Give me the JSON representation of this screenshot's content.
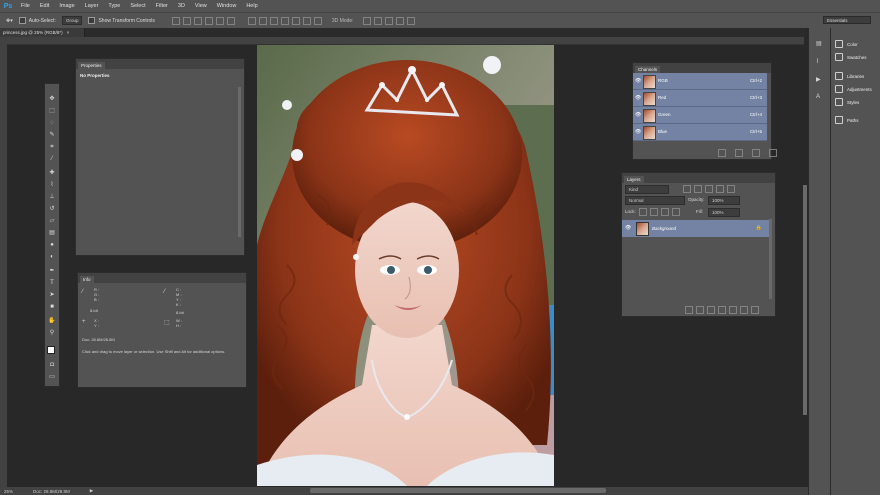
{
  "app": {
    "logo": "Ps"
  },
  "menu": [
    "File",
    "Edit",
    "Image",
    "Layer",
    "Type",
    "Select",
    "Filter",
    "3D",
    "View",
    "Window",
    "Help"
  ],
  "options": {
    "auto_select_label": "Auto-Select:",
    "auto_select_value": "Group",
    "transform_label": "Show Transform Controls",
    "mode_3d": "3D Mode:",
    "workspace": "Essentials"
  },
  "document": {
    "tab_title": "princess.jpg @ 25% (RGB/8*)",
    "zoom": "25%",
    "doc_size": "Doc: 28.8M/28.8M"
  },
  "properties": {
    "tab": "Properties",
    "content": "No Properties"
  },
  "info": {
    "tab": "Info",
    "rgb_labels": "R :\nG :\nB :",
    "cmyk_labels": "C :\nM :\nY :\nK :",
    "bit_left": "8-bit",
    "bit_right": "8-bit",
    "xy_labels": "X :\nY :",
    "wh_labels": "W :\nH :",
    "doc": "Doc: 28.8M/28.8M",
    "hint": "Click and drag to move layer or selection.  Use Shift and Alt for additional options."
  },
  "channels": {
    "tab": "Channels",
    "rows": [
      {
        "name": "RGB",
        "shortcut": "Ctrl+2"
      },
      {
        "name": "Red",
        "shortcut": "Ctrl+3"
      },
      {
        "name": "Green",
        "shortcut": "Ctrl+4"
      },
      {
        "name": "Blue",
        "shortcut": "Ctrl+5"
      }
    ]
  },
  "layers": {
    "tab": "Layers",
    "kind": "Kind",
    "blend": "Normal",
    "opacity_label": "Opacity:",
    "opacity_value": "100%",
    "lock_label": "Lock:",
    "fill_label": "Fill:",
    "fill_value": "100%",
    "layer_name": "Background"
  },
  "dock": [
    "Color",
    "Swatches",
    "Libraries",
    "Adjustments",
    "Styles",
    "Paths"
  ],
  "colors": {
    "panel": "#535353",
    "selection": "#7483a3",
    "accent": "#2fa3e8"
  }
}
